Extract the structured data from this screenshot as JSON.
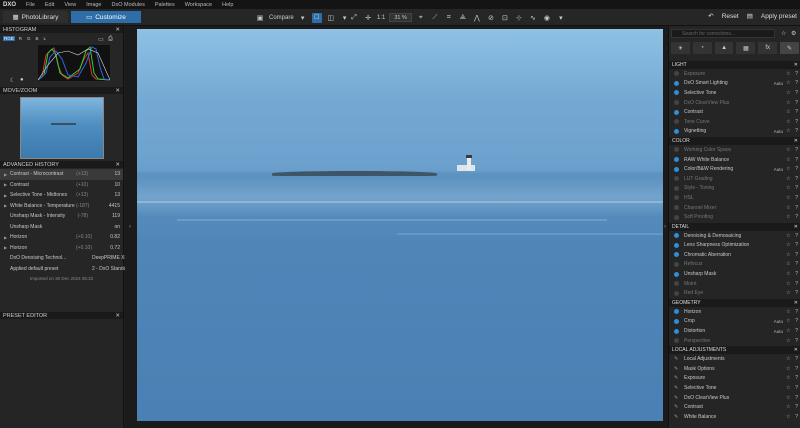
{
  "menubar": {
    "logo": "DXO",
    "items": [
      "File",
      "Edit",
      "View",
      "Image",
      "DxO Modules",
      "Palettes",
      "Workspace",
      "Help"
    ]
  },
  "toolbar": {
    "tab_library": "PhotoLibrary",
    "tab_customize": "Customize",
    "compare": "Compare",
    "zoom": "31 %",
    "one_to_one": "1:1",
    "reset": "Reset",
    "apply_preset": "Apply preset"
  },
  "histogram": {
    "title": "HISTOGRAM",
    "channels": [
      "RGB",
      "R",
      "G",
      "B",
      "L"
    ]
  },
  "move_zoom": {
    "title": "MOVE/ZOOM"
  },
  "advanced_history": {
    "title": "ADVANCED HISTORY",
    "rows": [
      {
        "name": "Contrast - Microcontrast",
        "change": "(+13)",
        "value": "13",
        "selected": true,
        "arrow": true
      },
      {
        "name": "Contrast",
        "change": "(+10)",
        "value": "10",
        "selected": false,
        "arrow": true
      },
      {
        "name": "Selective Tone - Midtones",
        "change": "(+13)",
        "value": "13",
        "selected": false,
        "arrow": true
      },
      {
        "name": "White Balance - Temperature",
        "change": "(-187)",
        "value": "4415",
        "selected": false,
        "arrow": true
      },
      {
        "name": "Unsharp Mask - Intensity",
        "change": "(-78)",
        "value": "119",
        "selected": false,
        "arrow": false
      },
      {
        "name": "Unsharp Mask",
        "change": "",
        "value": "on",
        "selected": false,
        "arrow": false
      },
      {
        "name": "Horizon",
        "change": "(+0.10)",
        "value": "0.82",
        "selected": false,
        "arrow": true
      },
      {
        "name": "Horizon",
        "change": "(+0.10)",
        "value": "0.72",
        "selected": false,
        "arrow": true
      },
      {
        "name": "DxO Denoising Technol...",
        "change": "",
        "value": "DeepPRIME XD/X...",
        "selected": false,
        "arrow": false
      },
      {
        "name": "Applied default preset",
        "change": "",
        "value": "2 - DxO Standard",
        "selected": false,
        "arrow": false
      }
    ],
    "footer": "Imported on 30 Dec 2024 06:33"
  },
  "preset_editor": {
    "title": "PRESET EDITOR"
  },
  "right_panel": {
    "search_placeholder": "Search for corrections...",
    "sections": [
      {
        "title": "LIGHT",
        "tools": [
          {
            "name": "Exposure",
            "active": false,
            "auto": ""
          },
          {
            "name": "DxO Smart Lighting",
            "active": true,
            "auto": "Auto"
          },
          {
            "name": "Selective Tone",
            "active": true,
            "auto": ""
          },
          {
            "name": "DxO ClearView Plus",
            "active": false,
            "auto": ""
          },
          {
            "name": "Contrast",
            "active": true,
            "auto": ""
          },
          {
            "name": "Tone Curve",
            "active": false,
            "auto": ""
          },
          {
            "name": "Vignetting",
            "active": true,
            "auto": "Auto"
          }
        ]
      },
      {
        "title": "COLOR",
        "tools": [
          {
            "name": "Working Color Space",
            "active": false,
            "auto": ""
          },
          {
            "name": "RAW White Balance",
            "active": true,
            "auto": ""
          },
          {
            "name": "Color/B&W Rendering",
            "active": true,
            "auto": "Auto"
          },
          {
            "name": "LUT Grading",
            "active": false,
            "auto": ""
          },
          {
            "name": "Style - Toning",
            "active": false,
            "auto": ""
          },
          {
            "name": "HSL",
            "active": false,
            "auto": ""
          },
          {
            "name": "Channel Mixer",
            "active": false,
            "auto": ""
          },
          {
            "name": "Soft Proofing",
            "active": false,
            "auto": ""
          }
        ]
      },
      {
        "title": "DETAIL",
        "tools": [
          {
            "name": "Denoising & Demosaicing",
            "active": true,
            "auto": ""
          },
          {
            "name": "Lens Sharpness Optimization",
            "active": true,
            "auto": ""
          },
          {
            "name": "Chromatic Aberration",
            "active": true,
            "auto": ""
          },
          {
            "name": "Refocus",
            "active": false,
            "auto": ""
          },
          {
            "name": "Unsharp Mask",
            "active": true,
            "auto": ""
          },
          {
            "name": "Moiré",
            "active": false,
            "auto": ""
          },
          {
            "name": "Red Eye",
            "active": false,
            "auto": ""
          }
        ]
      },
      {
        "title": "GEOMETRY",
        "tools": [
          {
            "name": "Horizon",
            "active": true,
            "auto": ""
          },
          {
            "name": "Crop",
            "active": true,
            "auto": "Auto"
          },
          {
            "name": "Distortion",
            "active": true,
            "auto": "Auto"
          },
          {
            "name": "Perspective",
            "active": false,
            "auto": ""
          }
        ]
      },
      {
        "title": "LOCAL ADJUSTMENTS",
        "tools": [
          {
            "name": "Local Adjustments",
            "active": false,
            "auto": ""
          },
          {
            "name": "Mask Options",
            "active": false,
            "auto": ""
          },
          {
            "name": "Exposure",
            "active": false,
            "auto": ""
          },
          {
            "name": "Selective Tone",
            "active": false,
            "auto": ""
          },
          {
            "name": "DxO ClearView Plus",
            "active": false,
            "auto": ""
          },
          {
            "name": "Contrast",
            "active": false,
            "auto": ""
          },
          {
            "name": "White Balance",
            "active": false,
            "auto": ""
          }
        ]
      }
    ]
  },
  "colors": {
    "accent": "#2d6ea8",
    "active_dot": "#2d8fd8",
    "background": "#1e1e1e"
  }
}
